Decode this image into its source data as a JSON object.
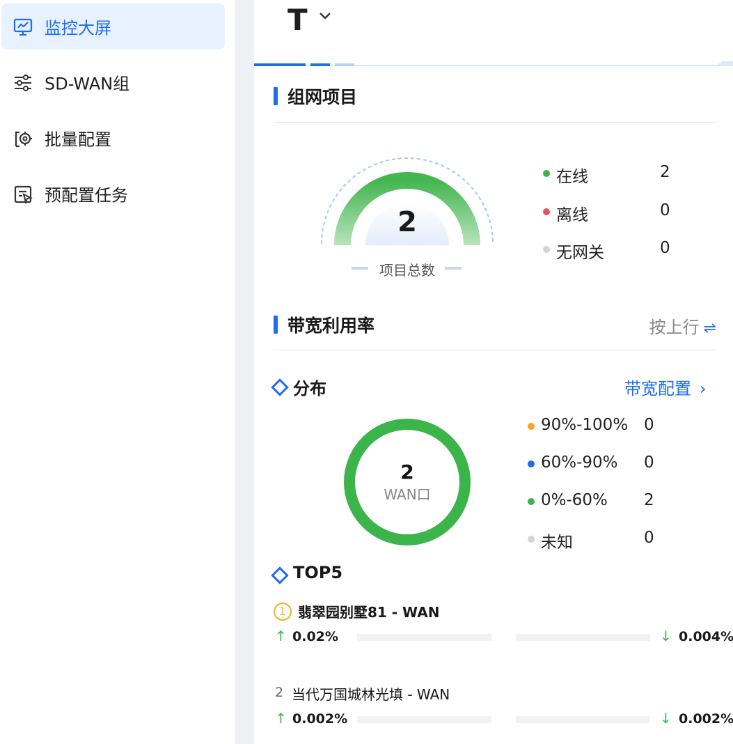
{
  "sidebar": {
    "items": [
      {
        "label": "监控大屏",
        "icon": "monitor-chart-icon",
        "active": true
      },
      {
        "label": "SD-WAN组",
        "icon": "sliders-icon",
        "active": false
      },
      {
        "label": "批量配置",
        "icon": "gear-config-icon",
        "active": false
      },
      {
        "label": "预配置任务",
        "icon": "task-cursor-icon",
        "active": false
      }
    ]
  },
  "header": {
    "project_initial": "T",
    "dropdown_icon": "chevron-down-icon"
  },
  "projects": {
    "title": "组网项目",
    "total": "2",
    "caption": "项目总数",
    "legend": [
      {
        "label": "在线",
        "value": "2",
        "color": "#3bb54a"
      },
      {
        "label": "离线",
        "value": "0",
        "color": "#f0505a"
      },
      {
        "label": "无网关",
        "value": "0",
        "color": "#d4d4d4"
      }
    ]
  },
  "bandwidth": {
    "title": "带宽利用率",
    "switch_label": "按上行",
    "switch_icon": "swap-arrows-icon",
    "distribution": {
      "title": "分布",
      "config_link": "带宽配置",
      "total": "2",
      "unit": "WAN口",
      "legend": [
        {
          "label": "90%-100%",
          "value": "0",
          "color": "#f5a623"
        },
        {
          "label": "60%-90%",
          "value": "0",
          "color": "#1e6cf0"
        },
        {
          "label": "0%-60%",
          "value": "2",
          "color": "#3bb54a"
        },
        {
          "label": "未知",
          "value": "0",
          "color": "#d4d4d4"
        }
      ]
    },
    "top5": {
      "title": "TOP5",
      "items": [
        {
          "rank": "1",
          "name": "翡翠园别墅81 - WAN",
          "up": "0.02%",
          "down": "0.004%"
        },
        {
          "rank": "2",
          "name": "当代万国城林光填 - WAN",
          "up": "0.002%",
          "down": "0.002%"
        }
      ]
    }
  },
  "colors": {
    "accent": "#1e6cf0",
    "green": "#3bb54a",
    "active_bg": "#e8f1ff"
  }
}
